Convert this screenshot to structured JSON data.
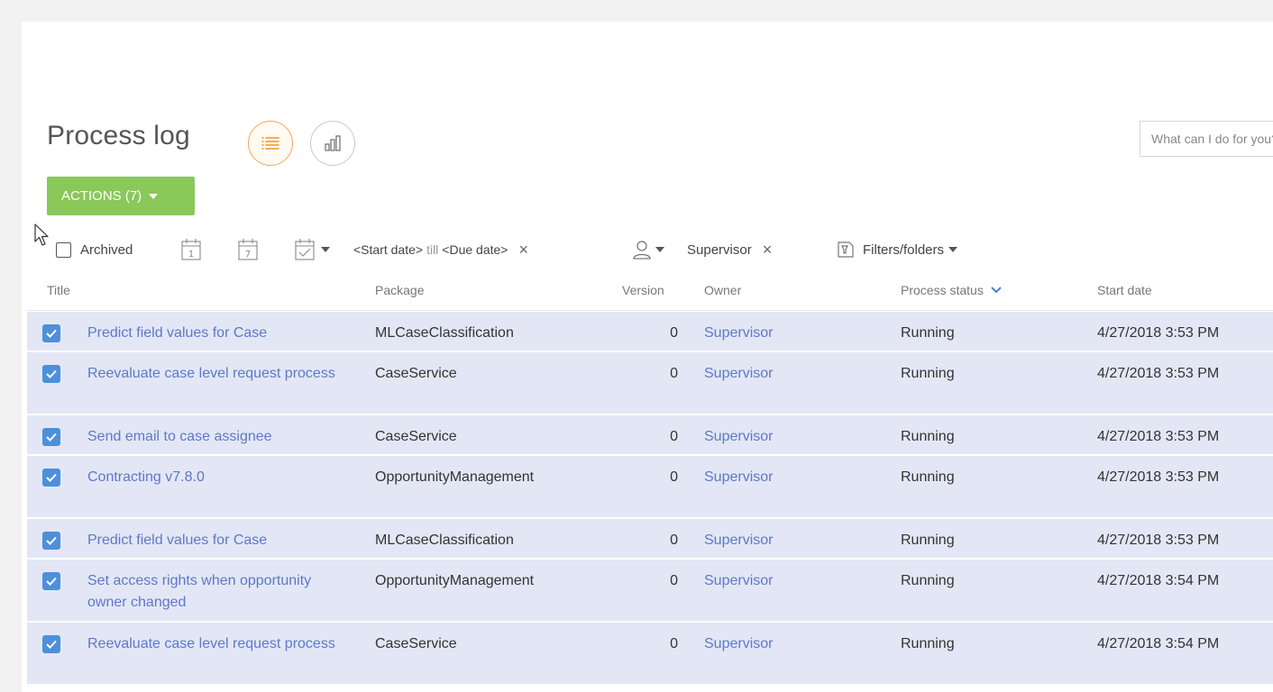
{
  "page": {
    "title": "Process log",
    "search_placeholder": "What can I do for you?"
  },
  "actions": {
    "label": "ACTIONS (7)"
  },
  "filters": {
    "archived_label": "Archived",
    "day_calendar_number": "1",
    "week_calendar_number": "7",
    "period_start": "<Start date>",
    "period_till": "till",
    "period_due": "<Due date>",
    "owner_value": "Supervisor",
    "folders_label": "Filters/folders"
  },
  "columns": {
    "title": "Title",
    "package": "Package",
    "version": "Version",
    "owner": "Owner",
    "status": "Process status",
    "start": "Start date"
  },
  "rows": [
    {
      "title": "Predict field values for Case",
      "package": "MLCaseClassification",
      "version": "0",
      "owner": "Supervisor",
      "status": "Running",
      "start": "4/27/2018 3:53 PM"
    },
    {
      "title": "Reevaluate case level request process",
      "package": "CaseService",
      "version": "0",
      "owner": "Supervisor",
      "status": "Running",
      "start": "4/27/2018 3:53 PM"
    },
    {
      "title": "Send email to case assignee",
      "package": "CaseService",
      "version": "0",
      "owner": "Supervisor",
      "status": "Running",
      "start": "4/27/2018 3:53 PM"
    },
    {
      "title": "Contracting v7.8.0",
      "package": "OpportunityManagement",
      "version": "0",
      "owner": "Supervisor",
      "status": "Running",
      "start": "4/27/2018 3:53 PM"
    },
    {
      "title": "Predict field values for Case",
      "package": "MLCaseClassification",
      "version": "0",
      "owner": "Supervisor",
      "status": "Running",
      "start": "4/27/2018 3:53 PM"
    },
    {
      "title": "Set access rights when opportunity owner changed",
      "package": "OpportunityManagement",
      "version": "0",
      "owner": "Supervisor",
      "status": "Running",
      "start": "4/27/2018 3:54 PM"
    },
    {
      "title": "Reevaluate case level request process",
      "package": "CaseService",
      "version": "0",
      "owner": "Supervisor",
      "status": "Running",
      "start": "4/27/2018 3:54 PM"
    }
  ],
  "colors": {
    "accent_green": "#8ac85a",
    "selected_row": "#e3e7f5",
    "link_blue": "#5d78c9",
    "checkbox_blue": "#4d90d9",
    "active_view_orange": "#f5a75a"
  },
  "icons": [
    "list-view-icon",
    "chart-view-icon",
    "calendar-day-icon",
    "calendar-week-icon",
    "calendar-period-icon",
    "user-icon",
    "filter-folder-icon",
    "chevron-down-icon",
    "close-icon",
    "check-icon",
    "mouse-pointer-icon"
  ]
}
